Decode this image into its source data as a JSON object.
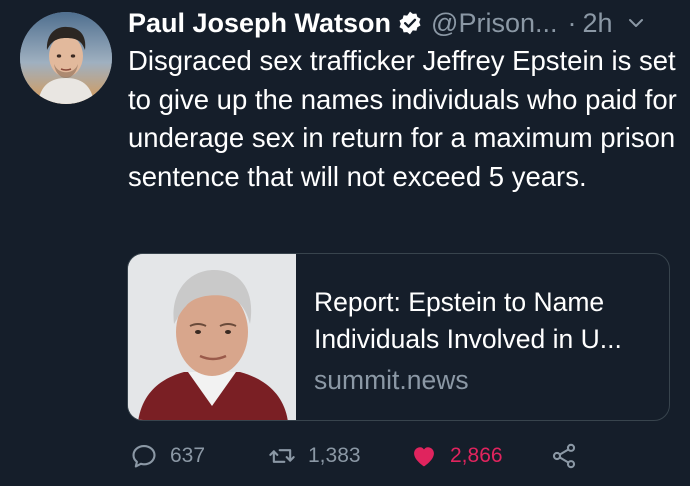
{
  "tweet": {
    "author_name": "Paul Joseph Watson",
    "handle": "@Prison...",
    "separator": "·",
    "time": "2h",
    "text": "Disgraced sex trafficker Jeffrey Epstein is set to give up the names individuals who paid for underage sex in return for a maximum prison sentence that will not exceed 5 years."
  },
  "card": {
    "title": "Report: Epstein to Name Individuals Involved in U...",
    "domain": "summit.news"
  },
  "actions": {
    "replies": "637",
    "retweets": "1,383",
    "likes": "2,866"
  },
  "colors": {
    "background": "#151e2a",
    "text": "#ffffff",
    "secondary": "#8b98a5",
    "like": "#e0245e",
    "verified": "#ffffff"
  },
  "icons": {
    "verified": "verified-badge-icon",
    "caret": "chevron-down-icon",
    "reply": "reply-icon",
    "retweet": "retweet-icon",
    "like": "heart-icon",
    "share": "share-icon"
  }
}
